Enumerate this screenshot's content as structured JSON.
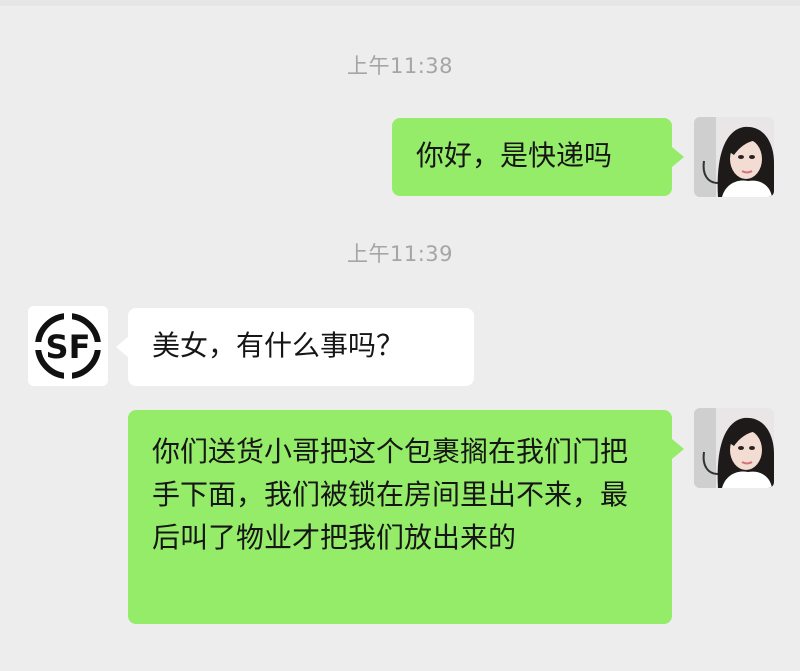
{
  "chat": {
    "messages": [
      {
        "type": "timestamp",
        "text": "上午11:38"
      },
      {
        "type": "outgoing",
        "sender": "user",
        "text": "你好，是快递吗"
      },
      {
        "type": "timestamp",
        "text": "上午11:39"
      },
      {
        "type": "incoming",
        "sender": "SF",
        "text": "美女，有什么事吗？"
      },
      {
        "type": "outgoing",
        "sender": "user",
        "text": "你们送货小哥把这个包裹搁在我们门把手下面，我们被锁在房间里出不来，最后叫了物业才把我们放出来的"
      }
    ]
  },
  "avatars": {
    "sf_logo_text": "SF"
  },
  "colors": {
    "background": "#ededed",
    "outgoing_bubble": "#95ec69",
    "incoming_bubble": "#ffffff",
    "timestamp": "#a5a5a5",
    "sf_black": "#111111"
  }
}
